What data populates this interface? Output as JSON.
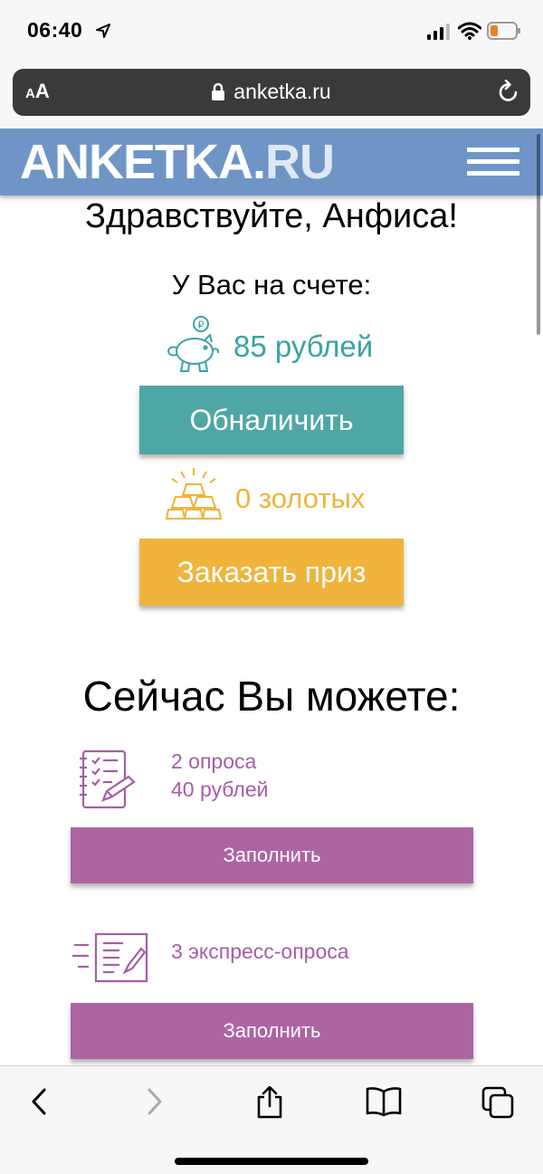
{
  "status_bar": {
    "time": "06:40"
  },
  "browser": {
    "aa_label": "AA",
    "url": "anketka.ru"
  },
  "site": {
    "logo_main": "ANKETKA.",
    "logo_suffix": "RU"
  },
  "account": {
    "greeting": "Здравствуйте, Анфиса!",
    "balance_label": "У Вас на счете:",
    "rubles": "85 рублей",
    "cash_button": "Обналичить",
    "gold": "0 золотых",
    "prize_button": "Заказать приз"
  },
  "tasks": {
    "title": "Сейчас Вы можете:",
    "items": [
      {
        "line1": "2 опроса",
        "line2": "40 рублей",
        "button": "Заполнить"
      },
      {
        "line1": "3 экспресс-опроса",
        "button": "Заполнить"
      }
    ]
  },
  "colors": {
    "header": "#6f95c6",
    "teal": "#4fa7a5",
    "gold": "#f0b43c",
    "purple": "#ad65a2"
  }
}
